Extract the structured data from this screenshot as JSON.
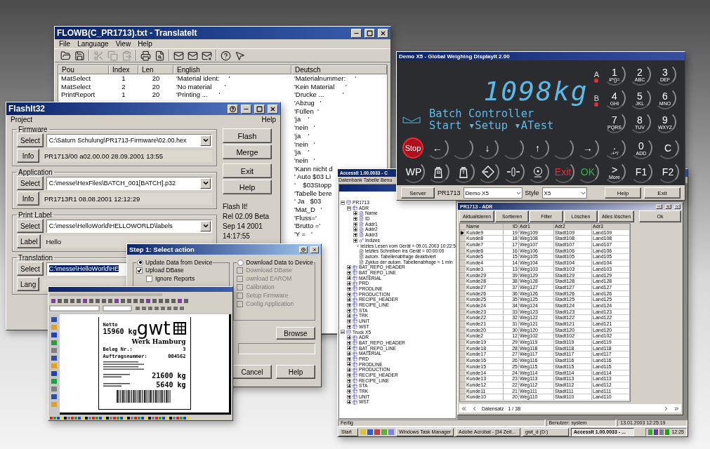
{
  "translate_window": {
    "title": "FLOWB(C_PR1713).txt - TranslateIt",
    "menu": [
      "File",
      "Language",
      "View",
      "Help"
    ],
    "columns": [
      "Pou",
      "Index",
      "Len",
      "English",
      "Deutsch"
    ],
    "rows": [
      {
        "pou": "MatSelect",
        "index": "1",
        "len": "20",
        "english": "'Material ident:     '",
        "deutsch": "'Materialnummer:     '"
      },
      {
        "pou": "MatSelect",
        "index": "2",
        "len": "20",
        "english": "'No material       '",
        "deutsch": "'Kein Material      '"
      },
      {
        "pou": "PrintReport",
        "index": "1",
        "len": "20",
        "english": "'Printing ...      '",
        "deutsch": "'Drucke ...          '"
      },
      {
        "deutsch": "'Abzug   '"
      },
      {
        "deutsch": "'Füllen  '"
      },
      {
        "deutsch": "'ja    '"
      },
      {
        "deutsch": "'nein   '"
      },
      {
        "deutsch": "'ja    '"
      },
      {
        "deutsch": "'nein   '"
      },
      {
        "deutsch": "'ja    '"
      },
      {
        "deutsch": "'nein   '"
      },
      {
        "deutsch": "'Kann nicht d"
      },
      {
        "deutsch": "' Auto $03 Li"
      },
      {
        "deutsch": "'    $03Stopp"
      },
      {
        "deutsch": "'Tabelle bere"
      },
      {
        "deutsch": "' Ja   $03"
      },
      {
        "deutsch": "'Mat_D   '"
      },
      {
        "deutsch": "'Fluss='"
      },
      {
        "deutsch": "'Brutto ='"
      },
      {
        "deutsch": "'Y =   '"
      }
    ]
  },
  "flashit_window": {
    "title": "FlashIt32",
    "menu": [
      "Project",
      "Help"
    ],
    "groups": [
      {
        "legend": "Firmware",
        "rows": [
          {
            "button": "Select",
            "kind": "combo",
            "value": "C:\\Saturn Schulung\\PR1713-Firmware\\02.00.hex",
            "highlighted": false
          },
          {
            "button": "Info",
            "kind": "info",
            "value": "PR1713/00 a02.00.00 28.09.2001 13:55"
          }
        ]
      },
      {
        "legend": "Application",
        "rows": [
          {
            "button": "Select",
            "kind": "combo",
            "value": "C:\\messe\\HexFiles\\BATCH_001[BATCH].p32",
            "highlighted": false
          },
          {
            "button": "Info",
            "kind": "info",
            "value": "PR1713R1 08.08.2001 12:12:29"
          }
        ]
      },
      {
        "legend": "Print Label",
        "rows": [
          {
            "button": "Select",
            "kind": "combo",
            "value": "C:\\messe\\HelloWorld\\HELLOWORLD\\labels",
            "highlighted": false
          },
          {
            "button": "Label",
            "kind": "info",
            "value": "Hello"
          }
        ]
      },
      {
        "legend": "Translation",
        "rows": [
          {
            "button": "Select",
            "kind": "combo",
            "value": "C:\\messe\\HelloWorld\\HE",
            "highlighted": true
          },
          {
            "button": "Lang",
            "kind": "info"
          }
        ]
      }
    ],
    "buttons": [
      "Flash",
      "Merge",
      "Exit",
      "Help"
    ],
    "version": [
      "Flash It!",
      "Rel 02.09 Beta",
      "Sep 14 2001",
      "14:17:55"
    ]
  },
  "step_dialog": {
    "title": "Step 1: Select action",
    "options": [
      {
        "label": "Update Data from Device",
        "selected": true,
        "items": [
          {
            "label": "Upload DBase",
            "checked": true,
            "disabled": false,
            "children": [
              {
                "label": "Ignore Reports",
                "checked": false,
                "disabled": false
              }
            ]
          }
        ]
      },
      {
        "label": "Download Data to Device",
        "selected": false,
        "items": [
          {
            "label": "Download DBase",
            "checked": false,
            "disabled": true
          },
          {
            "label": "ownload EAROM",
            "checked": false,
            "disabled": true
          },
          {
            "label": "Calibration",
            "checked": false,
            "disabled": true
          },
          {
            "label": "Setup Firmware",
            "checked": false,
            "disabled": true
          },
          {
            "label": "Config Application",
            "checked": false,
            "disabled": true
          }
        ]
      }
    ],
    "browse": "Browse",
    "buttons": [
      "Cancel",
      "Help"
    ]
  },
  "label_window": {
    "label": {
      "net_caption": "Netto",
      "net_weight": "15960 kg",
      "logo": "gwt",
      "site": "Werk Hamburg",
      "fields": [
        {
          "name": "Beleg Nr.:",
          "value": "3"
        },
        {
          "name": "Auftragsnummer:",
          "value": "004562"
        }
      ],
      "weights": [
        "21600 kg",
        "5640 kg"
      ]
    }
  },
  "weighing_window": {
    "title": "Demo X5 - Global Weighing DisplayIt 2.00",
    "reading": "1098kg",
    "indicators": [
      {
        "label": "A",
        "lit": true
      },
      {
        "label": "B",
        "lit": true
      }
    ],
    "lines": [
      "Batch Controller",
      "Start ▾Setup ▾ATest"
    ],
    "keypad": [
      {
        "label": "1",
        "sub": "#*()="
      },
      {
        "label": "2",
        "sub": "ABC"
      },
      {
        "label": "3",
        "sub": "DEF"
      },
      {
        "label": "4",
        "sub": "GHI"
      },
      {
        "label": "5",
        "sub": "JKL"
      },
      {
        "label": "6",
        "sub": "MNO"
      },
      {
        "label": "7",
        "sub": "PQRS"
      },
      {
        "label": "8",
        "sub": "TUV"
      },
      {
        "label": "9",
        "sub": "WXYZ"
      }
    ],
    "function_rows": [
      [
        {
          "kind": "stop",
          "label": "Stop"
        },
        {
          "kind": "text",
          "label": "←"
        },
        {
          "kind": "blank"
        },
        {
          "kind": "text",
          "label": "↓"
        },
        {
          "kind": "blank"
        },
        {
          "kind": "text",
          "label": "↑"
        },
        {
          "kind": "blank"
        },
        {
          "kind": "text",
          "label": "→"
        }
      ],
      [
        {
          "kind": "text",
          "label": "WP"
        },
        {
          "kind": "weight",
          "label": "B"
        },
        {
          "kind": "weight",
          "label": "T"
        },
        {
          "kind": "tare"
        },
        {
          "kind": "zero"
        },
        {
          "kind": "target"
        },
        {
          "kind": "text",
          "label": "Exit",
          "color": "#e0303a"
        },
        {
          "kind": "text",
          "label": "OK",
          "color": "#2fb24a"
        }
      ]
    ],
    "side_rows": [
      [
        {
          "kind": "text",
          "label": ".",
          "sub": "-+*/"
        },
        {
          "kind": "text",
          "label": "0",
          "sub": "ADD"
        },
        {
          "kind": "text",
          "label": "C"
        }
      ],
      [
        {
          "kind": "text",
          "label": ">",
          "sub": "More"
        },
        {
          "kind": "text",
          "label": "F1"
        },
        {
          "kind": "text",
          "label": "F2"
        }
      ]
    ],
    "footer": {
      "server": "Server",
      "device_label": "PR1713",
      "device": "Demo X5",
      "style_label": "Style",
      "style": "X5",
      "buttons": [
        "Help",
        "Exit"
      ]
    }
  },
  "access_window": {
    "title": "AccessIt 1.00.0033 - C",
    "menu": [
      "Datenbank",
      "Tabelle",
      "Benu"
    ],
    "tree": [
      {
        "label": "PR1713",
        "kind": "db",
        "expanded": true,
        "children": [
          {
            "label": "ADR",
            "kind": "table",
            "expanded": true,
            "children": [
              {
                "label": "Name",
                "kind": "field",
                "expanded": false
              },
              {
                "label": "ID",
                "kind": "field",
                "expanded": false
              },
              {
                "label": "Addr1",
                "kind": "field",
                "expanded": false
              },
              {
                "label": "Addr2",
                "kind": "field",
                "expanded": false
              },
              {
                "label": "Addr3",
                "kind": "field",
                "expanded": false
              },
              {
                "label": "Indizes",
                "kind": "index",
                "expanded": false
              },
              {
                "label": "letztes Lesen vom Gerät = 09.01.2003 10:22:5",
                "kind": "info"
              },
              {
                "label": "letztes Schreiben ins Gerät = 00:00:00",
                "kind": "info"
              },
              {
                "label": "autom. Tabellenabfrage deaktiviert",
                "kind": "info"
              },
              {
                "label": "Zyklus der autom. Tabellenabfrage = 1 min",
                "kind": "info"
              }
            ]
          },
          {
            "label": "BAT_REPO_HEADER",
            "kind": "table",
            "expanded": false
          },
          {
            "label": "BAT_REPO_LINE",
            "kind": "table",
            "expanded": false
          },
          {
            "label": "MATERIAL",
            "kind": "table",
            "expanded": false
          },
          {
            "label": "PRD",
            "kind": "table",
            "expanded": false
          },
          {
            "label": "PRODLINE",
            "kind": "table",
            "expanded": false
          },
          {
            "label": "PRODUCTION",
            "kind": "table",
            "expanded": false
          },
          {
            "label": "RECIPE_HEADER",
            "kind": "table",
            "expanded": false
          },
          {
            "label": "RECIPE_LINE",
            "kind": "table",
            "expanded": false
          },
          {
            "label": "STA",
            "kind": "table",
            "expanded": false
          },
          {
            "label": "TRK",
            "kind": "table",
            "expanded": false
          },
          {
            "label": "UNIT",
            "kind": "table",
            "expanded": false
          },
          {
            "label": "WST",
            "kind": "table",
            "expanded": false
          }
        ]
      },
      {
        "label": "Truck X5",
        "kind": "db",
        "expanded": true,
        "children": [
          {
            "label": "ADR",
            "kind": "table",
            "expanded": false
          },
          {
            "label": "BAT_REPO_HEADER",
            "kind": "table",
            "expanded": false
          },
          {
            "label": "BAT_REPO_LINE",
            "kind": "table",
            "expanded": false
          },
          {
            "label": "MATERIAL",
            "kind": "table",
            "expanded": false
          },
          {
            "label": "PRD",
            "kind": "table",
            "expanded": false
          },
          {
            "label": "PRODLINE",
            "kind": "table",
            "expanded": false
          },
          {
            "label": "PRODUCTION",
            "kind": "table",
            "expanded": false
          },
          {
            "label": "RECIPE_HEADER",
            "kind": "table",
            "expanded": false
          },
          {
            "label": "RECIPE_LINE",
            "kind": "table",
            "expanded": false
          },
          {
            "label": "STA",
            "kind": "table",
            "expanded": false
          },
          {
            "label": "TRK",
            "kind": "table",
            "expanded": false
          },
          {
            "label": "UNIT",
            "kind": "table",
            "expanded": false
          },
          {
            "label": "WST",
            "kind": "table",
            "expanded": false
          }
        ]
      }
    ],
    "table_window": {
      "title": "PR1713 - ADR",
      "buttons": [
        "Aktualisieren",
        "Sortieren",
        "Filter",
        "Löschen",
        "Alles löschen",
        "Ok"
      ],
      "columns": [
        "Name",
        "ID",
        "Adr1",
        "Adr2",
        "Adr3"
      ],
      "rows": [
        {
          "cells": [
            "Kunde9",
            "19",
            "Weg109",
            "Stadt109",
            "Land109"
          ],
          "selected": true
        },
        {
          "cells": [
            "Kunde8",
            "18",
            "Weg108",
            "Stadt108",
            "Land108"
          ],
          "selected": false
        },
        {
          "cells": [
            "Kunde7",
            "17",
            "Weg107",
            "Stadt107",
            "Land107"
          ],
          "selected": false
        },
        {
          "cells": [
            "Kunde6",
            "16",
            "Weg106",
            "Stadt106",
            "Land106"
          ],
          "selected": false
        },
        {
          "cells": [
            "Kunde5",
            "15",
            "Weg105",
            "Stadt105",
            "Land105"
          ],
          "selected": false
        },
        {
          "cells": [
            "Kunde4",
            "14",
            "Weg104",
            "Stadt104",
            "Land104"
          ],
          "selected": false
        },
        {
          "cells": [
            "Kunde3",
            "13",
            "Weg103",
            "Stadt103",
            "Land103"
          ],
          "selected": false
        },
        {
          "cells": [
            "Kunde29",
            "39",
            "Weg129",
            "Stadt129",
            "Land129"
          ],
          "selected": false
        },
        {
          "cells": [
            "Kunde28",
            "38",
            "Weg128",
            "Stadt128",
            "Land128"
          ],
          "selected": false
        },
        {
          "cells": [
            "Kunde27",
            "37",
            "Weg127",
            "Stadt127",
            "Land127"
          ],
          "selected": false
        },
        {
          "cells": [
            "Kunde26",
            "36",
            "Weg126",
            "Stadt126",
            "Land126"
          ],
          "selected": false
        },
        {
          "cells": [
            "Kunde25",
            "35",
            "Weg125",
            "Stadt125",
            "Land125"
          ],
          "selected": false
        },
        {
          "cells": [
            "Kunde24",
            "34",
            "Weg124",
            "Stadt124",
            "Land124"
          ],
          "selected": false
        },
        {
          "cells": [
            "Kunde23",
            "33",
            "Weg123",
            "Stadt123",
            "Land123"
          ],
          "selected": false
        },
        {
          "cells": [
            "Kunde22",
            "32",
            "Weg122",
            "Stadt122",
            "Land122"
          ],
          "selected": false
        },
        {
          "cells": [
            "Kunde21",
            "31",
            "Weg121",
            "Stadt121",
            "Land121"
          ],
          "selected": false
        },
        {
          "cells": [
            "Kunde20",
            "30",
            "Weg120",
            "Stadt120",
            "Land120"
          ],
          "selected": false
        },
        {
          "cells": [
            "Kunde2",
            "12",
            "Weg102",
            "Stadt102",
            "Land102"
          ],
          "selected": false
        },
        {
          "cells": [
            "Kunde19",
            "29",
            "Weg119",
            "Stadt119",
            "Land119"
          ],
          "selected": false
        },
        {
          "cells": [
            "Kunde18",
            "28",
            "Weg118",
            "Stadt118",
            "Land118"
          ],
          "selected": false
        },
        {
          "cells": [
            "Kunde17",
            "27",
            "Weg117",
            "Stadt117",
            "Land117"
          ],
          "selected": false
        },
        {
          "cells": [
            "Kunde16",
            "26",
            "Weg116",
            "Stadt116",
            "Land116"
          ],
          "selected": false
        },
        {
          "cells": [
            "Kunde15",
            "25",
            "Weg115",
            "Stadt115",
            "Land115"
          ],
          "selected": false
        },
        {
          "cells": [
            "Kunde14",
            "24",
            "Weg114",
            "Stadt114",
            "Land114"
          ],
          "selected": false
        },
        {
          "cells": [
            "Kunde13",
            "23",
            "Weg113",
            "Stadt113",
            "Land113"
          ],
          "selected": false
        },
        {
          "cells": [
            "Kunde12",
            "22",
            "Weg112",
            "Stadt112",
            "Land112"
          ],
          "selected": false
        },
        {
          "cells": [
            "Kunde11",
            "21",
            "Weg111",
            "Stadt111",
            "Land111"
          ],
          "selected": false
        },
        {
          "cells": [
            "Kunde10",
            "20",
            "Weg110",
            "Stadt110",
            "Land110"
          ],
          "selected": false
        }
      ],
      "record_label": "Datensatz",
      "record": "1 / 38"
    },
    "status": [
      "Fertig",
      "Benutzer: system",
      "13.01.2003 12:25:19"
    ],
    "taskbar": {
      "start": "Start",
      "tasks": [
        {
          "label": "Windows Task Manager",
          "selected": false
        },
        {
          "label": "Adobe Acrobat - [34 Zeit...",
          "selected": false
        },
        {
          "label": "gwt_d (D:)",
          "selected": false
        },
        {
          "label": "AccessIt 1.00.0033 - ...",
          "selected": true
        }
      ],
      "clock": "12:25"
    }
  }
}
